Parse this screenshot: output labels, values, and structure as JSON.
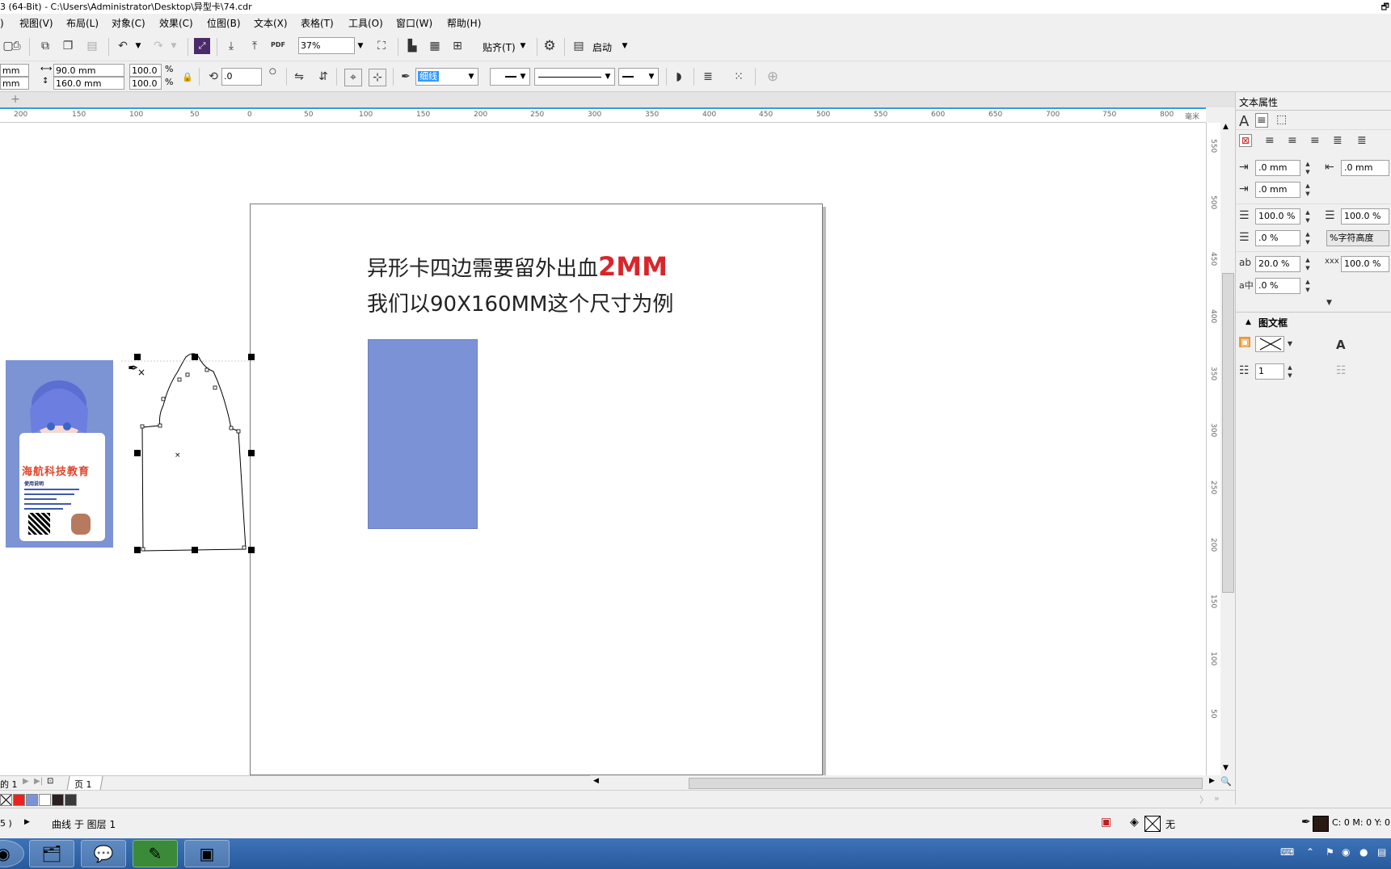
{
  "window": {
    "title": "3 (64-Bit) - C:\\Users\\Administrator\\Desktop\\异型卡\\74.cdr"
  },
  "menu": [
    ")",
    "视图(V)",
    "布局(L)",
    "对象(C)",
    "效果(C)",
    "位图(B)",
    "文本(X)",
    "表格(T)",
    "工具(O)",
    "窗口(W)",
    "帮助(H)"
  ],
  "toolbar": {
    "pdf_label": "PDF",
    "zoom_value": "37%",
    "snap_label": "贴齐(T)",
    "launch_label": "启动"
  },
  "propbar": {
    "x_value": "mm",
    "y_value": "mm",
    "width_value": "90.0 mm",
    "height_value": "160.0 mm",
    "scale_w": "100.0",
    "scale_h": "100.0",
    "percent": "%",
    "rotation_value": ".0",
    "outline_width": "细线"
  },
  "ruler": {
    "h_labels": [
      "200",
      "150",
      "100",
      "50",
      "0",
      "50",
      "100",
      "150",
      "200",
      "250",
      "300",
      "350",
      "400",
      "450",
      "500",
      "550",
      "600",
      "650",
      "700",
      "750",
      "800"
    ],
    "h_unit": "毫米",
    "v_labels": [
      "550",
      "500",
      "450",
      "400",
      "350",
      "300",
      "250",
      "200",
      "150",
      "100",
      "50"
    ]
  },
  "canvas": {
    "heading_line1": "异形卡四边需要留外出血",
    "heading_line1_emphasis": "2MM",
    "heading_line2": "我们以90X160MM这个尺寸为例",
    "card_brand_text": "海航科技教育",
    "card_small_text": "使用说明"
  },
  "panel": {
    "title": "文本属性",
    "indent_first": ".0 mm",
    "indent_right": ".0 mm",
    "indent_left": ".0 mm",
    "line_spacing": "100.0 %",
    "para_spacing_before": "100.0 %",
    "para_spacing_after": ".0 %",
    "char_height_label": "%字符高度",
    "char_spacing": "20.0 %",
    "word_spacing": "100.0 %",
    "lang_spacing": ".0 %",
    "frame_section": "图文框",
    "columns_value": "1"
  },
  "pagetabs": {
    "page_of": "的 1",
    "page_label": "页 1"
  },
  "palette": [
    "#ffffff",
    "#e8231f",
    "#7b92d6",
    "#ffffff",
    "#2a2020",
    "#3a3a3a"
  ],
  "status": {
    "coord": "5 )",
    "selection": "曲线 于 图层 1",
    "fill_label": "无",
    "outline_color": "C: 0 M: 0 Y: 0"
  },
  "colors": {
    "accent": "#3a9bd8",
    "card_blue": "#7b92d6",
    "emphasis_red": "#d8262b"
  }
}
